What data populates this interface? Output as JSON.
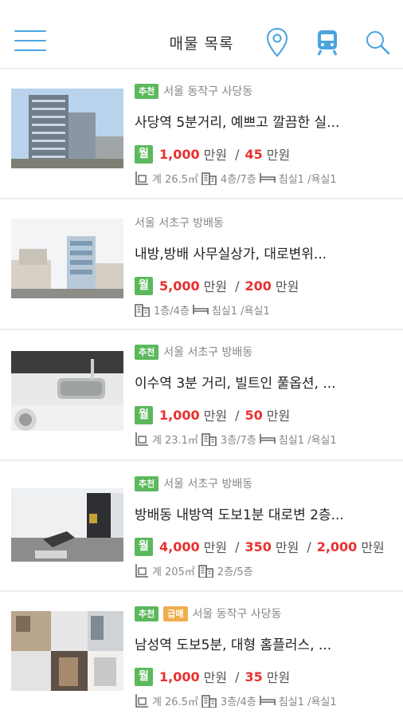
{
  "header": {
    "title": "매물 목록",
    "icons": [
      "menu-icon",
      "map-pin-icon",
      "subway-icon",
      "search-icon"
    ],
    "accent_color": "#4aa3df"
  },
  "badges": {
    "recommended": "추천",
    "urgent": "급매"
  },
  "price_labels": {
    "monthly": "월",
    "unit": "만원",
    "separator": "/"
  },
  "spec_labels": {
    "area_prefix": "계"
  },
  "colors": {
    "badge_green": "#5cb85c",
    "badge_orange": "#f0ad4e",
    "price_red": "#e8312f"
  },
  "listings": [
    {
      "location": "서울 동작구 사당동",
      "title": "사당역 5분거리, 예쁘고 깔끔한 실...",
      "deposit": "1,000",
      "rent": "45",
      "area": "26.5㎡",
      "floor": "4층/7층",
      "rooms": "침실1 /욕실1"
    },
    {
      "location": "서울 서초구 방배동",
      "title": "내방,방배 사무실상가, 대로변위...",
      "deposit": "5,000",
      "rent": "200",
      "floor": "1층/4층",
      "rooms": "침실1 /욕실1"
    },
    {
      "location": "서울 서초구 방배동",
      "title": "이수역 3분 거리, 빌트인 풀옵션, ...",
      "deposit": "1,000",
      "rent": "50",
      "area": "23.1㎡",
      "floor": "3층/7층",
      "rooms": "침실1 /욕실1"
    },
    {
      "location": "서울 서초구 방배동",
      "title": "방배동 내방역 도보1분 대로변 2층...",
      "deposit": "4,000",
      "rent": "350",
      "premium": "2,000",
      "area": "205㎡",
      "floor": "2층/5층"
    },
    {
      "location": "서울 동작구 사당동",
      "title": "남성역 도보5분, 대형 홈플러스, ...",
      "deposit": "1,000",
      "rent": "35",
      "area": "26.5㎡",
      "floor": "3층/4층",
      "rooms": "침실1 /욕실1"
    }
  ]
}
